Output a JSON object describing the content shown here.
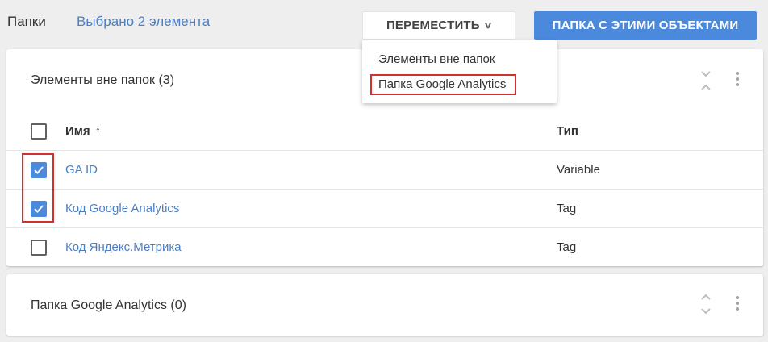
{
  "header": {
    "breadcrumb_folders": "Папки",
    "selected_count": "Выбрано 2 элемента",
    "move_button": "ПЕРЕМЕСТИТЬ",
    "folder_button": "ПАПКА С ЭТИМИ ОБЪЕКТАМИ"
  },
  "move_menu": {
    "items": [
      {
        "label": "Элементы вне папок"
      },
      {
        "label": "Папка Google Analytics",
        "highlighted": true
      }
    ]
  },
  "card_unfiled": {
    "title": "Элементы вне папок (3)",
    "columns": {
      "name": "Имя",
      "sort_indicator": "↑",
      "type": "Тип"
    },
    "rows": [
      {
        "name": "GA ID",
        "type": "Variable",
        "checked": true
      },
      {
        "name": "Код Google Analytics",
        "type": "Tag",
        "checked": true
      },
      {
        "name": "Код Яндекс.Метрика",
        "type": "Tag",
        "checked": false
      }
    ]
  },
  "card_folder": {
    "title": "Папка Google Analytics (0)"
  },
  "colors": {
    "accent": "#4a89dc",
    "link": "#4a7fc4",
    "highlight": "#d32f2f"
  },
  "icons": {
    "menu_chevron": "chevron-down-icon",
    "collapse": "collapse-icon",
    "expand": "expand-icon",
    "more": "more-vert-icon",
    "check": "check-icon"
  }
}
